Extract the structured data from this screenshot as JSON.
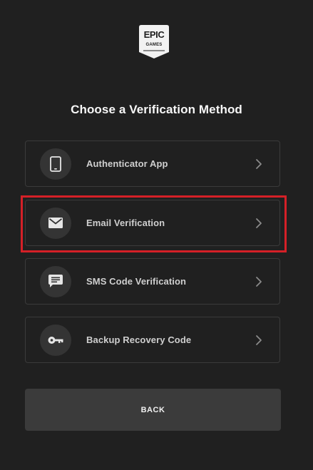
{
  "brand": {
    "line1": "EPIC",
    "line2": "GAMES"
  },
  "title": "Choose a Verification Method",
  "methods": [
    {
      "label": "Authenticator App",
      "icon": "phone-icon"
    },
    {
      "label": "Email Verification",
      "icon": "envelope-icon",
      "highlighted": true
    },
    {
      "label": "SMS Code Verification",
      "icon": "chat-bubble-icon"
    },
    {
      "label": "Backup Recovery Code",
      "icon": "key-icon"
    }
  ],
  "back_label": "BACK",
  "colors": {
    "background": "#202020",
    "card_border": "#3b3b3b",
    "icon_circle": "#343434",
    "button": "#3b3b3b",
    "highlight": "#d52027"
  }
}
